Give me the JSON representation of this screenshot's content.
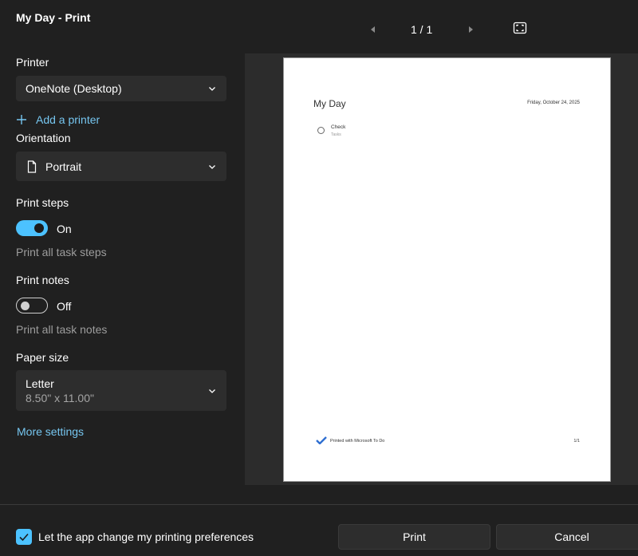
{
  "window": {
    "title": "My Day - Print"
  },
  "nav": {
    "page_indicator": "1 / 1"
  },
  "printer": {
    "label": "Printer",
    "value": "OneNote (Desktop)",
    "add_label": "Add a printer"
  },
  "orientation": {
    "label": "Orientation",
    "value": "Portrait"
  },
  "print_steps": {
    "label": "Print steps",
    "state": "On",
    "description": "Print all task steps"
  },
  "print_notes": {
    "label": "Print notes",
    "state": "Off",
    "description": "Print all task notes"
  },
  "paper_size": {
    "label": "Paper size",
    "value": "Letter",
    "dimensions": "8.50\" x 11.00\""
  },
  "more_settings": "More settings",
  "preview": {
    "title": "My Day",
    "date": "Friday, October 24, 2025",
    "task_title": "Check",
    "task_list": "Tasks",
    "footer": "Printed with Microsoft To Do",
    "page": "1/1"
  },
  "footer": {
    "checkbox_label": "Let the app change my printing preferences",
    "print_label": "Print",
    "cancel_label": "Cancel"
  },
  "colors": {
    "accent": "#4cc2ff",
    "link": "#76c6f0",
    "background": "#202020"
  }
}
